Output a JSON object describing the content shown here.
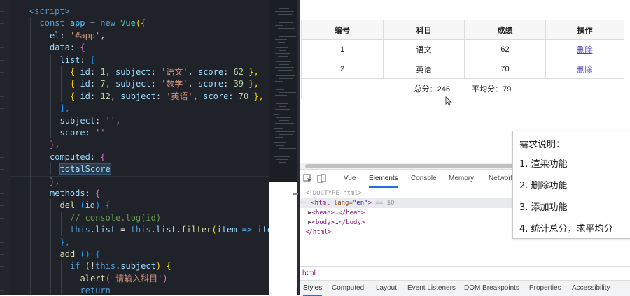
{
  "editor": {
    "lines": [
      {
        "indent": 0,
        "tokens": [
          {
            "t": "<script>",
            "c": "t-tag"
          }
        ]
      },
      {
        "indent": 1,
        "tokens": [
          {
            "t": "const ",
            "c": "t-kw"
          },
          {
            "t": "app",
            "c": "t-var"
          },
          {
            "t": " = ",
            "c": ""
          },
          {
            "t": "new ",
            "c": "t-kw"
          },
          {
            "t": "Vue",
            "c": "t-cls"
          },
          {
            "t": "({",
            "c": "t-br1"
          }
        ]
      },
      {
        "indent": 2,
        "tokens": [
          {
            "t": "el",
            "c": "t-id"
          },
          {
            "t": ": ",
            "c": ""
          },
          {
            "t": "'#app'",
            "c": "t-str"
          },
          {
            "t": ",",
            "c": ""
          }
        ]
      },
      {
        "indent": 2,
        "tokens": [
          {
            "t": "data",
            "c": "t-id"
          },
          {
            "t": ": ",
            "c": ""
          },
          {
            "t": "{",
            "c": "t-br2"
          }
        ]
      },
      {
        "indent": 3,
        "tokens": [
          {
            "t": "list",
            "c": "t-id"
          },
          {
            "t": ": ",
            "c": ""
          },
          {
            "t": "[",
            "c": "t-br3"
          }
        ]
      },
      {
        "indent": 4,
        "tokens": [
          {
            "t": "{ ",
            "c": "t-br1"
          },
          {
            "t": "id",
            "c": "t-id"
          },
          {
            "t": ": ",
            "c": ""
          },
          {
            "t": "1",
            "c": "t-num"
          },
          {
            "t": ", ",
            "c": ""
          },
          {
            "t": "subject",
            "c": "t-id"
          },
          {
            "t": ": ",
            "c": ""
          },
          {
            "t": "'语文'",
            "c": "t-str"
          },
          {
            "t": ", ",
            "c": ""
          },
          {
            "t": "score",
            "c": "t-id"
          },
          {
            "t": ": ",
            "c": ""
          },
          {
            "t": "62",
            "c": "t-num"
          },
          {
            "t": " },",
            "c": "t-br1"
          }
        ]
      },
      {
        "indent": 4,
        "tokens": [
          {
            "t": "{ ",
            "c": "t-br1"
          },
          {
            "t": "id",
            "c": "t-id"
          },
          {
            "t": ": ",
            "c": ""
          },
          {
            "t": "7",
            "c": "t-num"
          },
          {
            "t": ", ",
            "c": ""
          },
          {
            "t": "subject",
            "c": "t-id"
          },
          {
            "t": ": ",
            "c": ""
          },
          {
            "t": "'数学'",
            "c": "t-str"
          },
          {
            "t": ", ",
            "c": ""
          },
          {
            "t": "score",
            "c": "t-id"
          },
          {
            "t": ": ",
            "c": ""
          },
          {
            "t": "39",
            "c": "t-num"
          },
          {
            "t": " },",
            "c": "t-br1"
          }
        ]
      },
      {
        "indent": 4,
        "tokens": [
          {
            "t": "{ ",
            "c": "t-br1"
          },
          {
            "t": "id",
            "c": "t-id"
          },
          {
            "t": ": ",
            "c": ""
          },
          {
            "t": "12",
            "c": "t-num"
          },
          {
            "t": ", ",
            "c": ""
          },
          {
            "t": "subject",
            "c": "t-id"
          },
          {
            "t": ": ",
            "c": ""
          },
          {
            "t": "'英语'",
            "c": "t-str"
          },
          {
            "t": ", ",
            "c": ""
          },
          {
            "t": "score",
            "c": "t-id"
          },
          {
            "t": ": ",
            "c": ""
          },
          {
            "t": "70",
            "c": "t-num"
          },
          {
            "t": " },",
            "c": "t-br1"
          }
        ]
      },
      {
        "indent": 3,
        "tokens": [
          {
            "t": "],",
            "c": "t-br3"
          }
        ]
      },
      {
        "indent": 3,
        "tokens": [
          {
            "t": "subject",
            "c": "t-id"
          },
          {
            "t": ": ",
            "c": ""
          },
          {
            "t": "''",
            "c": "t-str"
          },
          {
            "t": ",",
            "c": ""
          }
        ]
      },
      {
        "indent": 3,
        "tokens": [
          {
            "t": "score",
            "c": "t-id"
          },
          {
            "t": ": ",
            "c": ""
          },
          {
            "t": "''",
            "c": "t-str"
          }
        ]
      },
      {
        "indent": 2,
        "tokens": [
          {
            "t": "},",
            "c": "t-br2"
          }
        ]
      },
      {
        "indent": 2,
        "tokens": [
          {
            "t": "computed",
            "c": "t-id"
          },
          {
            "t": ": ",
            "c": ""
          },
          {
            "t": "{",
            "c": "t-br2"
          }
        ]
      },
      {
        "indent": 3,
        "tokens": [
          {
            "t": "totalScore",
            "c": "t-id hl"
          }
        ]
      },
      {
        "indent": 2,
        "tokens": [
          {
            "t": "},",
            "c": "t-br2"
          }
        ]
      },
      {
        "indent": 2,
        "tokens": [
          {
            "t": "methods",
            "c": "t-id"
          },
          {
            "t": ": ",
            "c": ""
          },
          {
            "t": "{",
            "c": "t-br2"
          }
        ]
      },
      {
        "indent": 3,
        "tokens": [
          {
            "t": "del",
            "c": "t-fn"
          },
          {
            "t": " (",
            "c": "t-br3"
          },
          {
            "t": "id",
            "c": "t-id"
          },
          {
            "t": ") ",
            "c": "t-br3"
          },
          {
            "t": "{",
            "c": "t-br3"
          }
        ]
      },
      {
        "indent": 4,
        "tokens": [
          {
            "t": "// console.log(id)",
            "c": "t-com"
          }
        ]
      },
      {
        "indent": 4,
        "tokens": [
          {
            "t": "this",
            "c": "t-kw"
          },
          {
            "t": ".",
            "c": ""
          },
          {
            "t": "list",
            "c": "t-id"
          },
          {
            "t": " = ",
            "c": ""
          },
          {
            "t": "this",
            "c": "t-kw"
          },
          {
            "t": ".",
            "c": ""
          },
          {
            "t": "list",
            "c": "t-id"
          },
          {
            "t": ".",
            "c": ""
          },
          {
            "t": "filter",
            "c": "t-fn"
          },
          {
            "t": "(",
            "c": "t-br1"
          },
          {
            "t": "item",
            "c": "t-id"
          },
          {
            "t": " => ",
            "c": "t-kw"
          },
          {
            "t": "iter",
            "c": "t-id"
          }
        ]
      },
      {
        "indent": 3,
        "tokens": [
          {
            "t": "},",
            "c": "t-br3"
          }
        ]
      },
      {
        "indent": 3,
        "tokens": [
          {
            "t": "add",
            "c": "t-fn"
          },
          {
            "t": " () ",
            "c": "t-br3"
          },
          {
            "t": "{",
            "c": "t-br3"
          }
        ]
      },
      {
        "indent": 4,
        "tokens": [
          {
            "t": "if",
            "c": "t-kw"
          },
          {
            "t": " (",
            "c": "t-br1"
          },
          {
            "t": "!",
            "c": ""
          },
          {
            "t": "this",
            "c": "t-kw"
          },
          {
            "t": ".",
            "c": ""
          },
          {
            "t": "subject",
            "c": "t-id"
          },
          {
            "t": ") ",
            "c": "t-br1"
          },
          {
            "t": "{",
            "c": "t-br1"
          }
        ]
      },
      {
        "indent": 5,
        "tokens": [
          {
            "t": "alert",
            "c": "t-fn"
          },
          {
            "t": "(",
            "c": "t-br2"
          },
          {
            "t": "'请输入科目'",
            "c": "t-str"
          },
          {
            "t": ")",
            "c": "t-br2"
          }
        ]
      },
      {
        "indent": 5,
        "tokens": [
          {
            "t": "return",
            "c": "t-kw"
          }
        ]
      }
    ]
  },
  "table": {
    "headers": [
      "编号",
      "科目",
      "成绩",
      "操作"
    ],
    "rows": [
      {
        "num": "1",
        "subject": "语文",
        "score": "62",
        "action": "删除"
      },
      {
        "num": "2",
        "subject": "英语",
        "score": "70",
        "action": "删除"
      }
    ],
    "total_label": "总分：246",
    "avg_label": "平均分：79"
  },
  "devtools": {
    "tabs": [
      "Vue",
      "Elements",
      "Console",
      "Memory",
      "Network"
    ],
    "active_tab": "Elements",
    "tree": {
      "doctype": "<!DOCTYPE html>",
      "html_open": "<html",
      "lang_name": "lang",
      "lang_value": "\"en\"",
      "html_close_bracket": ">",
      "dollar": " == $0",
      "head": "<head>…</head>",
      "body": "<body>…</body>",
      "html_end": "</html>",
      "ellipsis": "···"
    },
    "breadcrumb": "html",
    "subtabs": [
      "Styles",
      "Computed",
      "Layout",
      "Event Listeners",
      "DOM Breakpoints",
      "Properties",
      "Accessibility"
    ],
    "active_subtab": "Styles"
  },
  "requirements": {
    "title": "需求说明：",
    "items": [
      "1. 渲染功能",
      "2. 删除功能",
      "3. 添加功能",
      "4. 统计总分，求平均分"
    ]
  }
}
